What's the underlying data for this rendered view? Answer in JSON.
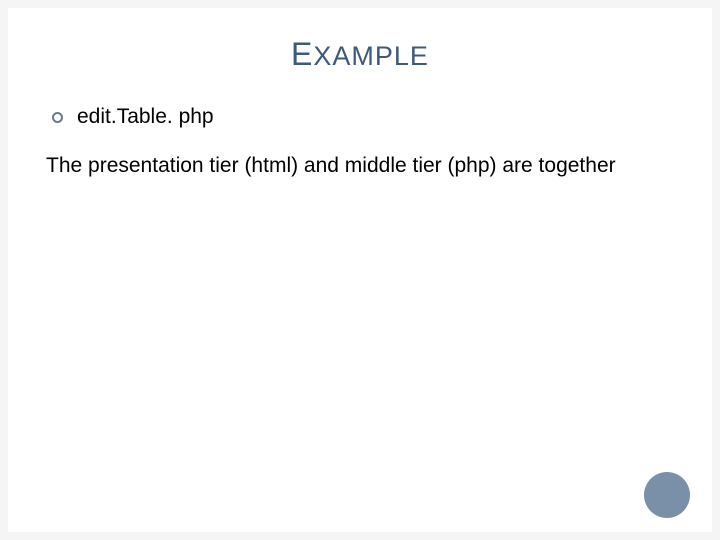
{
  "title": "XAMPLE",
  "title_first_letter": "E",
  "bullet": {
    "text": "edit.Table. php"
  },
  "body": "The presentation tier (html) and middle tier (php) are together"
}
